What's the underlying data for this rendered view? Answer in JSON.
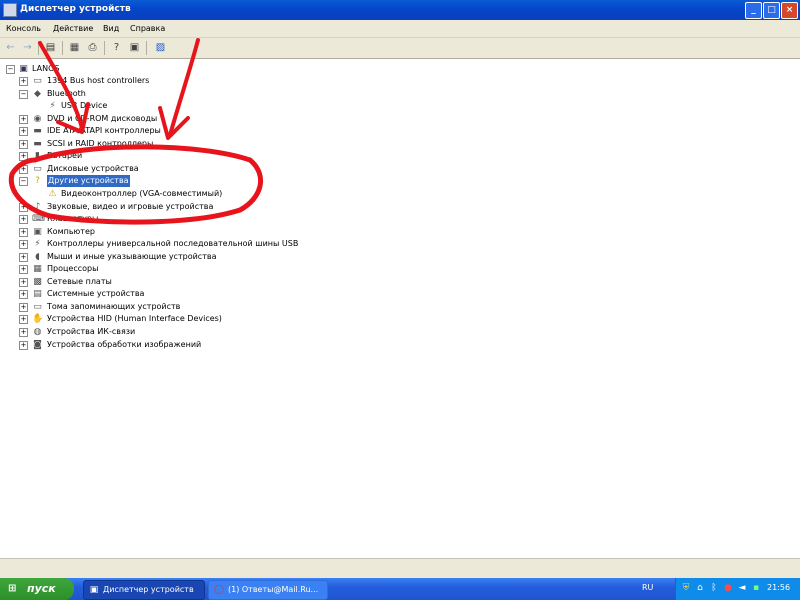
{
  "window": {
    "title": "Диспетчер устройств"
  },
  "menu": [
    "Консоль",
    "Действие",
    "Вид",
    "Справка"
  ],
  "toolbar": [
    "back-icon",
    "forward-icon",
    "view-icon",
    "properties-icon",
    "print-icon",
    "help-icon",
    "refresh-icon",
    "scan-icon"
  ],
  "tree": {
    "root": "LANOS",
    "items": [
      {
        "label": "1394 Bus host controllers",
        "icon": "bus-controller-icon",
        "expander": "+"
      },
      {
        "label": "Bluetooth",
        "icon": "bluetooth-icon",
        "expander": "-"
      },
      {
        "label": "USB Device",
        "icon": "usb-icon",
        "expander": "",
        "child": true
      },
      {
        "label": "DVD и CD-ROM дисководы",
        "icon": "dvd-drive-icon",
        "expander": "+"
      },
      {
        "label": "IDE ATA/ATAPI контроллеры",
        "icon": "ide-controller-icon",
        "expander": "+"
      },
      {
        "label": "SCSI и RAID контроллеры",
        "icon": "scsi-controller-icon",
        "expander": "+"
      },
      {
        "label": "Батареи",
        "icon": "battery-icon",
        "expander": "+"
      },
      {
        "label": "Дисковые устройства",
        "icon": "disk-drive-icon",
        "expander": "+"
      },
      {
        "label": "Другие устройства",
        "icon": "unknown-device-icon",
        "expander": "-",
        "selected": true
      },
      {
        "label": "Видеоконтроллер (VGA-совместимый)",
        "icon": "warning-device-icon",
        "expander": "",
        "child": true
      },
      {
        "label": "Звуковые, видео и игровые устройства",
        "icon": "sound-icon",
        "expander": "+"
      },
      {
        "label": "Клавиатуры",
        "icon": "keyboard-icon",
        "expander": "+"
      },
      {
        "label": "Компьютер",
        "icon": "computer-icon",
        "expander": "+"
      },
      {
        "label": "Контроллеры универсальной последовательной шины USB",
        "icon": "usb-icon",
        "expander": "+"
      },
      {
        "label": "Мыши и иные указывающие устройства",
        "icon": "mouse-icon",
        "expander": "+"
      },
      {
        "label": "Процессоры",
        "icon": "cpu-icon",
        "expander": "+"
      },
      {
        "label": "Сетевые платы",
        "icon": "network-card-icon",
        "expander": "+"
      },
      {
        "label": "Системные устройства",
        "icon": "system-device-icon",
        "expander": "+"
      },
      {
        "label": "Тома запоминающих устройств",
        "icon": "storage-volume-icon",
        "expander": "+"
      },
      {
        "label": "Устройства HID (Human Interface Devices)",
        "icon": "hid-icon",
        "expander": "+"
      },
      {
        "label": "Устройства ИК-связи",
        "icon": "infrared-icon",
        "expander": "+"
      },
      {
        "label": "Устройства обработки изображений",
        "icon": "imaging-icon",
        "expander": "+"
      }
    ]
  },
  "taskbar": {
    "start_label": "пуск",
    "tasks": [
      {
        "label": "Диспетчер устройств",
        "active": true
      },
      {
        "label": "(1) Ответы@Mail.Ru...",
        "active": false
      }
    ],
    "language": "RU",
    "clock": "21:56"
  },
  "annotation": {
    "color": "#e8141c"
  }
}
